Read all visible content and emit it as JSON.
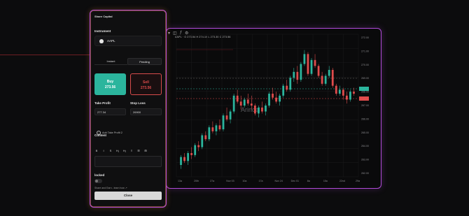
{
  "panel": {
    "title": "Share Capital",
    "instrument_label": "Instrument",
    "instrument_symbol": "AAPL",
    "tabs": [
      {
        "label": "Instant"
      },
      {
        "label": "Pending"
      }
    ],
    "buy_label": "Buy",
    "buy_price": "273.56",
    "sell_label": "Sell",
    "sell_price": "273.56",
    "take_profit_label": "Take Profit",
    "take_profit_value": "277.34",
    "stop_loss_label": "Stop Loss",
    "stop_loss_value": "26900",
    "add_tp_label": "Add Take Profit 2",
    "content_label": "Content",
    "format_buttons": [
      "B",
      "I",
      "S",
      "H₁",
      "H₂",
      "≡",
      "☰",
      "⊞"
    ],
    "locked_label": "locked",
    "share_text": "Share and Earn - learn how ↗",
    "close_label": "Close"
  },
  "chart": {
    "info": "AAPL · O 273.54  H 274.10  L 273.30  C 273.56",
    "watermark": "Arincel",
    "price_labels": [
      "272.00",
      "271.00",
      "270.00",
      "269.00",
      "268.00",
      "267.00",
      "266.00",
      "265.00",
      "264.00",
      "263.00",
      "262.00"
    ],
    "time_labels": [
      "13a",
      "20th",
      "27a",
      "Nov 03",
      "10a",
      "17a",
      "Nov 24",
      "Dec 01",
      "8a",
      "15a",
      "22nd",
      "29a"
    ],
    "colors": {
      "up": "#2bb59d",
      "down": "#e04c4c",
      "frame": "#b04bd8"
    }
  },
  "chart_data": {
    "type": "candlestick",
    "series": [
      {
        "values": [
          [
            246,
            251,
            244,
            250
          ],
          [
            250,
            252,
            247,
            248
          ],
          [
            248,
            253,
            246,
            252
          ],
          [
            252,
            255,
            249,
            251
          ],
          [
            251,
            257,
            250,
            256
          ],
          [
            256,
            258,
            253,
            255
          ],
          [
            255,
            262,
            254,
            261
          ],
          [
            261,
            263,
            258,
            259
          ],
          [
            259,
            266,
            258,
            265
          ],
          [
            265,
            268,
            262,
            263
          ],
          [
            263,
            267,
            261,
            266
          ],
          [
            266,
            269,
            263,
            264
          ],
          [
            264,
            272,
            263,
            271
          ],
          [
            271,
            275,
            268,
            269
          ],
          [
            269,
            274,
            267,
            273
          ],
          [
            273,
            282,
            272,
            281
          ],
          [
            281,
            284,
            277,
            278
          ],
          [
            278,
            281,
            274,
            276
          ],
          [
            276,
            280,
            275,
            279
          ],
          [
            279,
            282,
            276,
            277
          ],
          [
            277,
            281,
            274,
            276
          ],
          [
            276,
            277,
            271,
            272
          ],
          [
            272,
            276,
            270,
            275
          ],
          [
            275,
            278,
            272,
            273
          ],
          [
            273,
            277,
            271,
            276
          ],
          [
            276,
            283,
            275,
            282
          ],
          [
            282,
            285,
            279,
            280
          ],
          [
            280,
            283,
            277,
            278
          ],
          [
            278,
            282,
            276,
            281
          ],
          [
            281,
            287,
            280,
            286
          ],
          [
            286,
            289,
            283,
            284
          ],
          [
            284,
            291,
            283,
            290
          ],
          [
            290,
            295,
            288,
            293
          ],
          [
            293,
            296,
            287,
            289
          ],
          [
            289,
            298,
            288,
            297
          ],
          [
            297,
            304,
            296,
            302
          ],
          [
            302,
            303,
            291,
            292
          ],
          [
            292,
            300,
            291,
            299
          ],
          [
            299,
            302,
            295,
            296
          ],
          [
            296,
            297,
            290,
            291
          ],
          [
            291,
            293,
            286,
            287
          ],
          [
            287,
            292,
            286,
            291
          ],
          [
            291,
            296,
            290,
            294
          ],
          [
            294,
            295,
            285,
            286
          ],
          [
            286,
            287,
            281,
            282
          ],
          [
            282,
            286,
            281,
            284
          ],
          [
            284,
            285,
            279,
            281
          ],
          [
            281,
            283,
            277,
            279
          ],
          [
            279,
            284,
            278,
            283
          ],
          [
            283,
            285,
            281,
            282
          ]
        ]
      }
    ],
    "ylim": [
      240,
      312
    ]
  }
}
